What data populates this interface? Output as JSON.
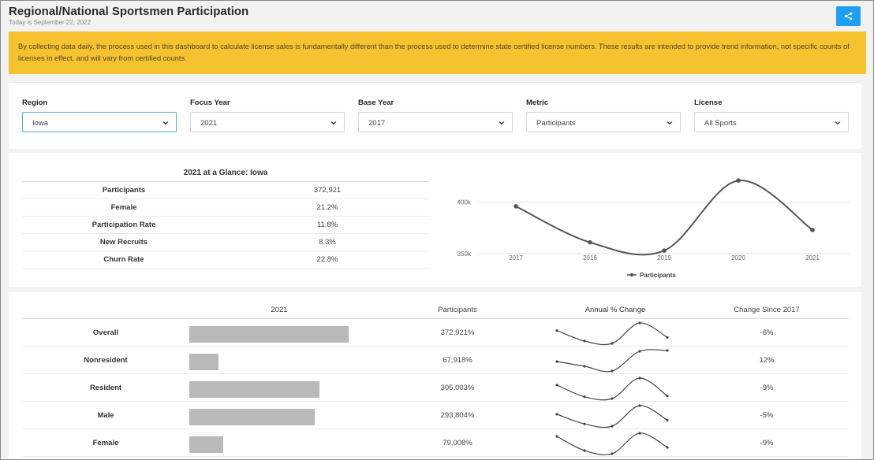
{
  "header": {
    "title": "Regional/National Sportsmen Participation",
    "subtitle": "Today is September 22, 2022"
  },
  "notice": "By collecting data daily, the process used in this dashboard to calculate license sales is fundamentally different than the process used to determine state certified license numbers. These results are intended to provide trend information, not specific counts of licenses in effect, and will vary from certified counts.",
  "filters": [
    {
      "label": "Region",
      "value": "Iowa"
    },
    {
      "label": "Focus Year",
      "value": "2021"
    },
    {
      "label": "Base Year",
      "value": "2017"
    },
    {
      "label": "Metric",
      "value": "Participants"
    },
    {
      "label": "License",
      "value": "All Sports"
    }
  ],
  "glance": {
    "title": "2021 at a Glance: Iowa",
    "rows": [
      {
        "label": "Participants",
        "value": "372,921"
      },
      {
        "label": "Female",
        "value": "21.2%"
      },
      {
        "label": "Participation Rate",
        "value": "11.8%"
      },
      {
        "label": "New Recruits",
        "value": "8.3%"
      },
      {
        "label": "Churn Rate",
        "value": "22.8%"
      }
    ]
  },
  "chart_data": {
    "type": "line",
    "x": [
      "2017",
      "2018",
      "2019",
      "2020",
      "2021"
    ],
    "series": [
      {
        "name": "Participants",
        "values": [
          396000,
          361000,
          353000,
          421000,
          373000
        ]
      }
    ],
    "y_ticks": [
      "350k",
      "400k"
    ],
    "ylim": [
      347000,
      425000
    ],
    "grid": true,
    "legend": "bottom",
    "color": "#555555"
  },
  "breakdown": {
    "headers": [
      "",
      "2021",
      "Participants",
      "Annual % Change",
      "Change Since 2017"
    ],
    "max_value": 372921,
    "rows": [
      {
        "label": "Overall",
        "value": 372921,
        "participants": "372,921%",
        "change": "-6%",
        "trend": [
          396000,
          361000,
          353000,
          421000,
          373000
        ]
      },
      {
        "label": "Nonresident",
        "value": 67918,
        "participants": "67,918%",
        "change": "12%",
        "trend": [
          61000,
          58000,
          55000,
          67500,
          68000
        ]
      },
      {
        "label": "Resident",
        "value": 305003,
        "participants": "305,003%",
        "change": "-9%",
        "trend": [
          335000,
          303000,
          298000,
          354000,
          305000
        ]
      },
      {
        "label": "Male",
        "value": 293804,
        "participants": "293,804%",
        "change": "-5%",
        "trend": [
          310000,
          284000,
          278000,
          333000,
          294000
        ]
      },
      {
        "label": "Female",
        "value": 79008,
        "participants": "79,008%",
        "change": "-9%",
        "trend": [
          86000,
          77000,
          75000,
          88000,
          79000
        ]
      }
    ]
  }
}
